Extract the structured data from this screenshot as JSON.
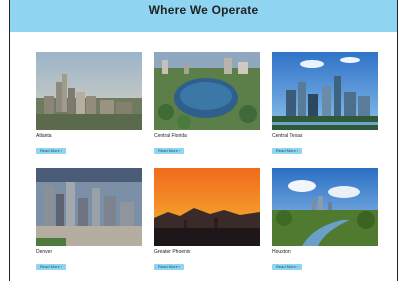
{
  "header": {
    "title": "Where We Operate"
  },
  "locations": [
    {
      "name": "Atlanta",
      "button": "Read More ›"
    },
    {
      "name": "Central Florida",
      "button": "Read More ›"
    },
    {
      "name": "Central Texas",
      "button": "Read More ›"
    },
    {
      "name": "Denver",
      "button": "Read More ›"
    },
    {
      "name": "Greater Phoenix",
      "button": "Read More ›"
    },
    {
      "name": "Houston",
      "button": "Read More ›"
    }
  ],
  "colors": {
    "header_bg": "#8fd4f1",
    "button_bg": "#8fd4f1"
  }
}
